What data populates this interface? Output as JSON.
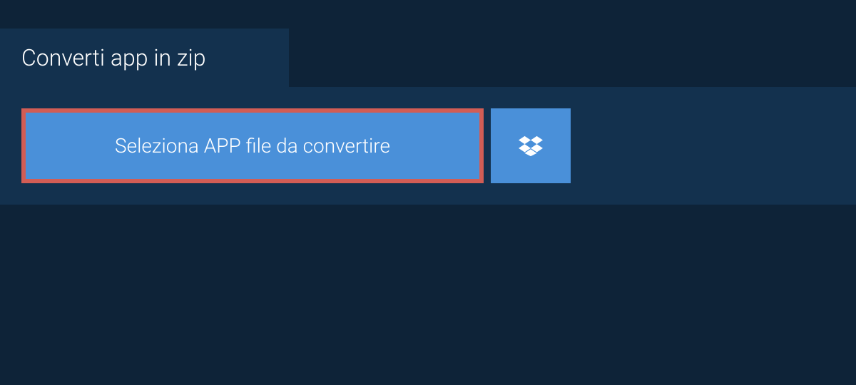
{
  "tab": {
    "title": "Converti app in zip"
  },
  "actions": {
    "select_file_label": "Seleziona APP file da convertire"
  }
}
